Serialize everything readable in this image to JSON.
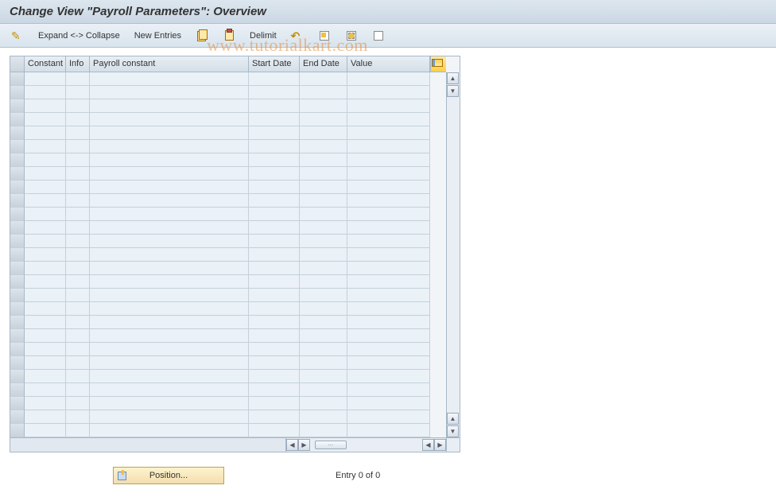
{
  "title": "Change View \"Payroll Parameters\": Overview",
  "toolbar": {
    "expand_collapse": "Expand <-> Collapse",
    "new_entries": "New Entries",
    "delimit": "Delimit"
  },
  "columns": {
    "constant": "Constant",
    "info": "Info",
    "payroll_constant": "Payroll constant",
    "start_date": "Start Date",
    "end_date": "End Date",
    "value": "Value"
  },
  "rows": [
    {
      "constant": "",
      "info": "",
      "payroll_constant": "",
      "start_date": "",
      "end_date": "",
      "value": ""
    },
    {
      "constant": "",
      "info": "",
      "payroll_constant": "",
      "start_date": "",
      "end_date": "",
      "value": ""
    },
    {
      "constant": "",
      "info": "",
      "payroll_constant": "",
      "start_date": "",
      "end_date": "",
      "value": ""
    },
    {
      "constant": "",
      "info": "",
      "payroll_constant": "",
      "start_date": "",
      "end_date": "",
      "value": ""
    },
    {
      "constant": "",
      "info": "",
      "payroll_constant": "",
      "start_date": "",
      "end_date": "",
      "value": ""
    },
    {
      "constant": "",
      "info": "",
      "payroll_constant": "",
      "start_date": "",
      "end_date": "",
      "value": ""
    },
    {
      "constant": "",
      "info": "",
      "payroll_constant": "",
      "start_date": "",
      "end_date": "",
      "value": ""
    },
    {
      "constant": "",
      "info": "",
      "payroll_constant": "",
      "start_date": "",
      "end_date": "",
      "value": ""
    },
    {
      "constant": "",
      "info": "",
      "payroll_constant": "",
      "start_date": "",
      "end_date": "",
      "value": ""
    },
    {
      "constant": "",
      "info": "",
      "payroll_constant": "",
      "start_date": "",
      "end_date": "",
      "value": ""
    },
    {
      "constant": "",
      "info": "",
      "payroll_constant": "",
      "start_date": "",
      "end_date": "",
      "value": ""
    },
    {
      "constant": "",
      "info": "",
      "payroll_constant": "",
      "start_date": "",
      "end_date": "",
      "value": ""
    },
    {
      "constant": "",
      "info": "",
      "payroll_constant": "",
      "start_date": "",
      "end_date": "",
      "value": ""
    },
    {
      "constant": "",
      "info": "",
      "payroll_constant": "",
      "start_date": "",
      "end_date": "",
      "value": ""
    },
    {
      "constant": "",
      "info": "",
      "payroll_constant": "",
      "start_date": "",
      "end_date": "",
      "value": ""
    },
    {
      "constant": "",
      "info": "",
      "payroll_constant": "",
      "start_date": "",
      "end_date": "",
      "value": ""
    },
    {
      "constant": "",
      "info": "",
      "payroll_constant": "",
      "start_date": "",
      "end_date": "",
      "value": ""
    },
    {
      "constant": "",
      "info": "",
      "payroll_constant": "",
      "start_date": "",
      "end_date": "",
      "value": ""
    },
    {
      "constant": "",
      "info": "",
      "payroll_constant": "",
      "start_date": "",
      "end_date": "",
      "value": ""
    },
    {
      "constant": "",
      "info": "",
      "payroll_constant": "",
      "start_date": "",
      "end_date": "",
      "value": ""
    },
    {
      "constant": "",
      "info": "",
      "payroll_constant": "",
      "start_date": "",
      "end_date": "",
      "value": ""
    },
    {
      "constant": "",
      "info": "",
      "payroll_constant": "",
      "start_date": "",
      "end_date": "",
      "value": ""
    },
    {
      "constant": "",
      "info": "",
      "payroll_constant": "",
      "start_date": "",
      "end_date": "",
      "value": ""
    },
    {
      "constant": "",
      "info": "",
      "payroll_constant": "",
      "start_date": "",
      "end_date": "",
      "value": ""
    },
    {
      "constant": "",
      "info": "",
      "payroll_constant": "",
      "start_date": "",
      "end_date": "",
      "value": ""
    },
    {
      "constant": "",
      "info": "",
      "payroll_constant": "",
      "start_date": "",
      "end_date": "",
      "value": ""
    },
    {
      "constant": "",
      "info": "",
      "payroll_constant": "",
      "start_date": "",
      "end_date": "",
      "value": ""
    }
  ],
  "footer": {
    "position_label": "Position...",
    "entry_status": "Entry 0 of 0"
  },
  "watermark": "www.tutorialkart.com"
}
